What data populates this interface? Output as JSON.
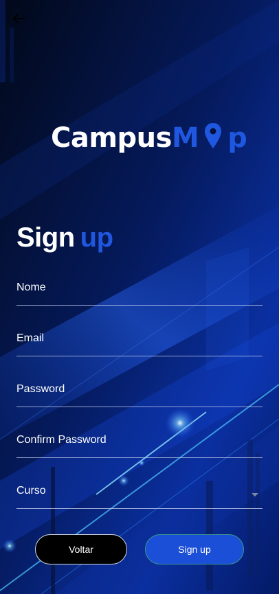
{
  "header": {
    "back_icon": "arrow-left-icon"
  },
  "logo": {
    "part_white": "Campus",
    "part_blue_1": "M",
    "part_blue_2": "p",
    "pin_icon": "map-pin-icon",
    "accent": "#1f57e0"
  },
  "form": {
    "title_white": "Sign",
    "title_blue": "up",
    "fields": {
      "nome": "Nome",
      "email": "Email",
      "password": "Password",
      "confirm_password": "Confirm Password",
      "curso": "Curso"
    }
  },
  "buttons": {
    "voltar": "Voltar",
    "signup": "Sign up"
  },
  "colors": {
    "background": "#020a26",
    "primary": "#1c4fd8"
  }
}
